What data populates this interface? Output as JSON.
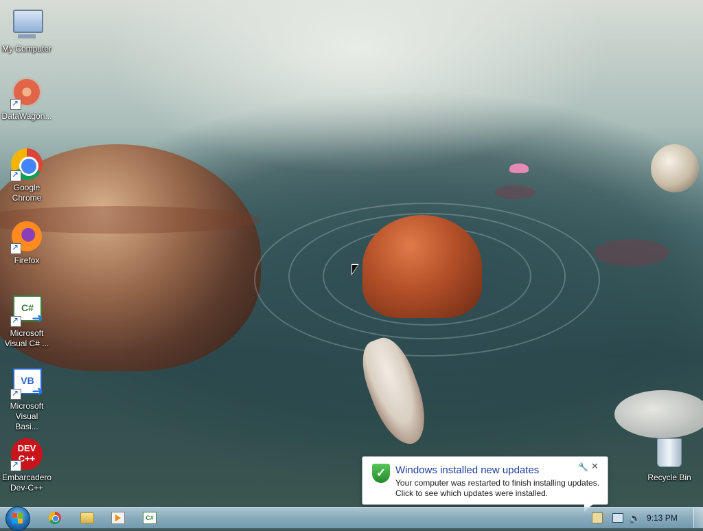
{
  "desktop": {
    "icons": [
      {
        "label": "My Computer",
        "icon": "computer-icon"
      },
      {
        "label": "DataWagon...",
        "icon": "datawagon-icon"
      },
      {
        "label": "Google Chrome",
        "icon": "chrome-icon"
      },
      {
        "label": "Firefox",
        "icon": "firefox-icon"
      },
      {
        "label": "Microsoft Visual C# ...",
        "icon": "visual-csharp-icon"
      },
      {
        "label": "Microsoft Visual Basi...",
        "icon": "visual-basic-icon"
      },
      {
        "label": "Embarcadero Dev-C++",
        "icon": "dev-cpp-icon"
      },
      {
        "label": "Recycle Bin",
        "icon": "recycle-bin-icon"
      }
    ],
    "csharp_glyph": "C#",
    "vb_glyph": "VB",
    "dev_glyph_line1": "DEV",
    "dev_glyph_line2": "C++"
  },
  "notification": {
    "title": "Windows installed new updates",
    "line1": "Your computer was restarted to finish installing updates.",
    "line2": "Click to see which updates were installed.",
    "shield_glyph": "✓",
    "close_glyph": "✕",
    "options_glyph": "🔧"
  },
  "taskbar": {
    "start_icon": "windows-start-icon",
    "pinned": [
      {
        "name": "chrome",
        "icon": "chrome-icon"
      },
      {
        "name": "windows-explorer",
        "icon": "folder-icon"
      },
      {
        "name": "media-player",
        "icon": "media-player-icon"
      },
      {
        "name": "visual-csharp",
        "icon": "visual-csharp-icon",
        "glyph": "C#"
      }
    ],
    "clock": "9:13 PM",
    "volume_glyph": "🔈"
  },
  "colors": {
    "notification_title": "#1e3d9a",
    "taskbar": "#96b9cd",
    "win_red": "#f25022",
    "win_green": "#7fba00",
    "win_blue": "#00a4ef",
    "win_yellow": "#ffb900"
  }
}
